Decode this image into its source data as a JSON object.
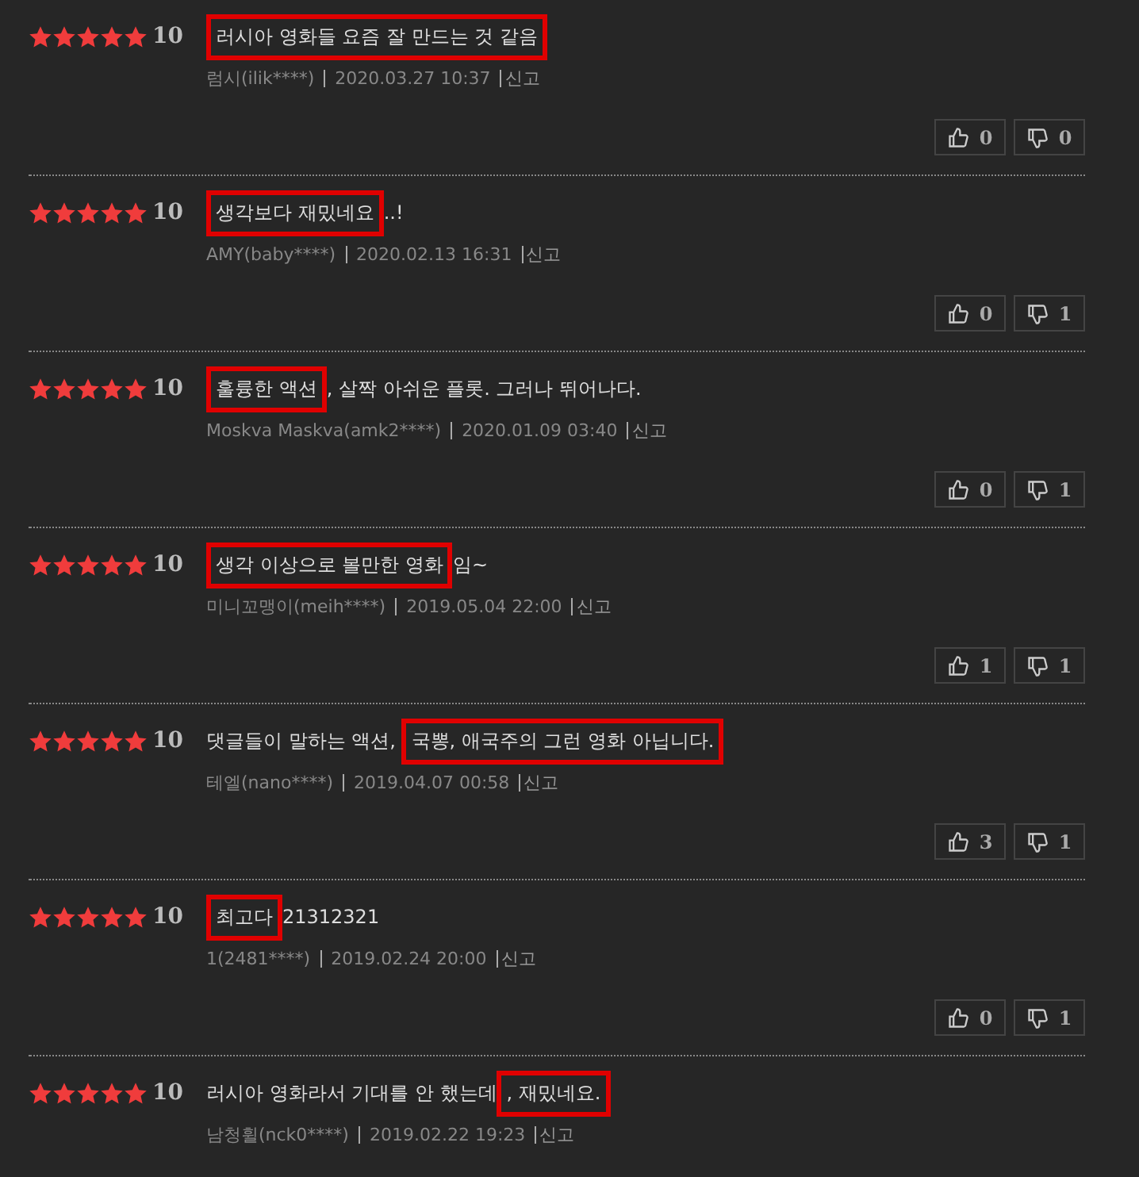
{
  "reviews": [
    {
      "stars": 5,
      "score": "10",
      "highlight": "러시아 영화들 요즘 잘 만드는 것 같음",
      "author": "럼시(ilik****)",
      "date": "2020.03.27 10:37",
      "report": "신고",
      "likes": "0",
      "dislikes": "0"
    },
    {
      "stars": 5,
      "score": "10",
      "highlight": "생각보다 재밌네요",
      "text_after": "..!",
      "author": "AMY(baby****)",
      "date": "2020.02.13 16:31",
      "report": "신고",
      "likes": "0",
      "dislikes": "1"
    },
    {
      "stars": 5,
      "score": "10",
      "highlight": "훌륭한 액션",
      "text_after": ", 살짝 아쉬운 플롯. 그러나 뛰어나다.",
      "author": "Moskva Maskva(amk2****)",
      "date": "2020.01.09 03:40",
      "report": "신고",
      "likes": "0",
      "dislikes": "1"
    },
    {
      "stars": 5,
      "score": "10",
      "highlight": "생각 이상으로 볼만한 영화",
      "text_after": "임~",
      "author": "미니꼬맹이(meih****)",
      "date": "2019.05.04 22:00",
      "report": "신고",
      "likes": "1",
      "dislikes": "1"
    },
    {
      "stars": 5,
      "score": "10",
      "text_before": "댓글들이 말하는 액션, ",
      "highlight": "국뽕, 애국주의 그런 영화 아닙니다.",
      "author": "테엘(nano****)",
      "date": "2019.04.07 00:58",
      "report": "신고",
      "likes": "3",
      "dislikes": "1"
    },
    {
      "stars": 5,
      "score": "10",
      "highlight": "최고다",
      "text_after": "21312321",
      "author": "1(2481****)",
      "date": "2019.02.24 20:00",
      "report": "신고",
      "likes": "0",
      "dislikes": "1"
    },
    {
      "stars": 5,
      "score": "10",
      "text_before": "러시아 영화라서 기대를 안 했는데",
      "highlight": ", 재밌네요.",
      "author": "남청휠(nck0****)",
      "date": "2019.02.22 19:23",
      "report": "신고"
    }
  ]
}
